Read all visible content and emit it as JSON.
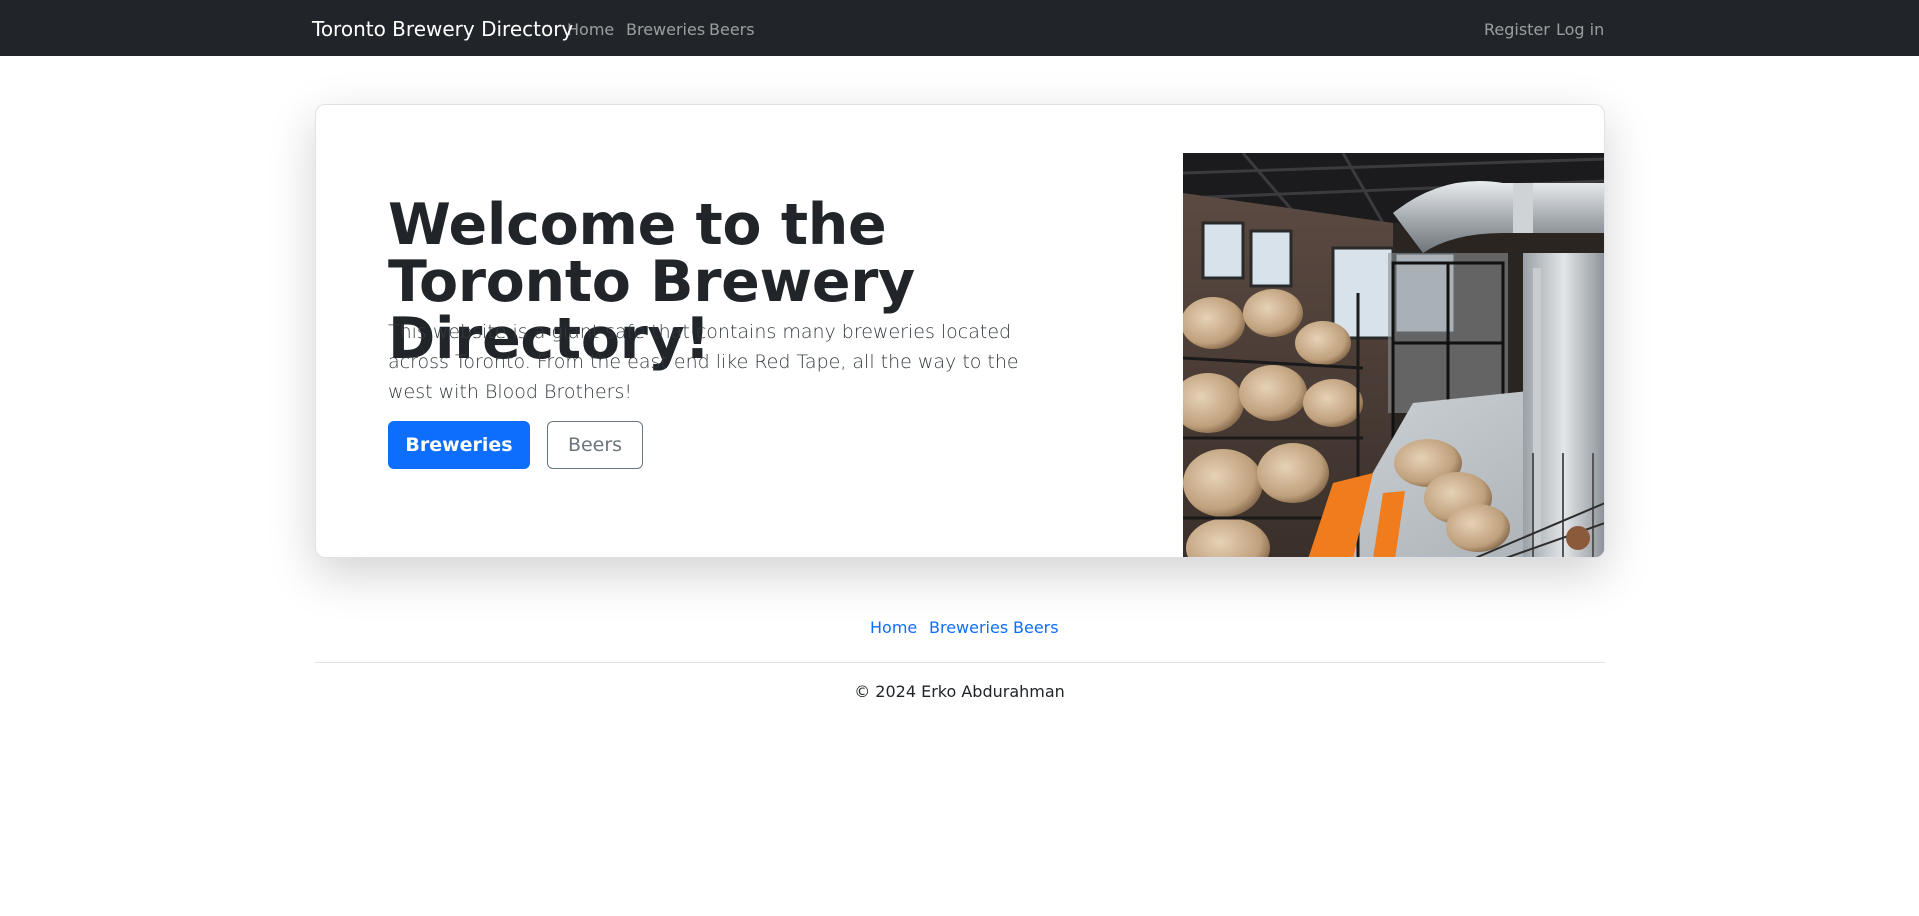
{
  "navbar": {
    "brand": "Toronto Brewery Directory",
    "links": [
      "Home",
      "Breweries",
      "Beers"
    ],
    "auth": [
      "Register",
      "Log in"
    ]
  },
  "hero": {
    "title": "Welcome to the Toronto Brewery Directory!",
    "text": "This website is a giant safe that contains many breweries located across Toronto. From the east end like Red Tape, all the way to the west with Blood Brothers!",
    "primary_button": "Breweries",
    "secondary_button": "Beers"
  },
  "footer": {
    "links": [
      "Home",
      "Breweries",
      "Beers"
    ],
    "copyright": "© 2024 Erko Abdurahman"
  },
  "colors": {
    "navbar_bg": "#212529",
    "primary": "#0d6efd",
    "secondary": "#6c757d"
  }
}
